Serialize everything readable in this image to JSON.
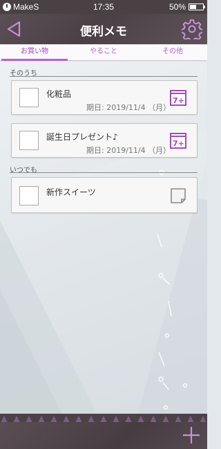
{
  "status_bar": {
    "carrier": "MakeS",
    "time": "17:35",
    "battery": "50%"
  },
  "header": {
    "title": "便利メモ",
    "back_icon": "back-arrow-icon",
    "settings_icon": "gear-icon"
  },
  "tabs": [
    {
      "label": "お買い物",
      "active": true
    },
    {
      "label": "やること",
      "active": false
    },
    {
      "label": "その他",
      "active": false
    }
  ],
  "sections": [
    {
      "label": "そのうち",
      "items": [
        {
          "title": "化粧品",
          "due": "期日: 2019/11/4 （月）",
          "icon": "calendar-plus-icon",
          "checked": false
        },
        {
          "title": "誕生日プレゼント♪",
          "due": "期日: 2019/11/4 （月）",
          "icon": "calendar-plus-icon",
          "checked": false
        }
      ]
    },
    {
      "label": "いつでも",
      "items": [
        {
          "title": "新作スイーツ",
          "due": "",
          "icon": "memo-note-icon",
          "checked": false
        }
      ]
    }
  ],
  "footer": {
    "add_icon": "plus-icon"
  },
  "colors": {
    "accent": "#b562cc",
    "header_bg": "#4a4046",
    "content_bg": "#e3e8ec"
  }
}
